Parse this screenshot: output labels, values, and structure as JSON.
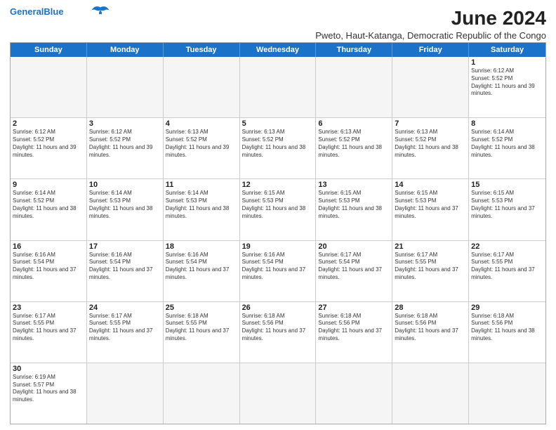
{
  "header": {
    "logo_line1": "General",
    "logo_line2": "Blue",
    "main_title": "June 2024",
    "subtitle": "Pweto, Haut-Katanga, Democratic Republic of the Congo"
  },
  "days_of_week": [
    "Sunday",
    "Monday",
    "Tuesday",
    "Wednesday",
    "Thursday",
    "Friday",
    "Saturday"
  ],
  "weeks": [
    {
      "cells": [
        {
          "day": "",
          "empty": true
        },
        {
          "day": "",
          "empty": true
        },
        {
          "day": "",
          "empty": true
        },
        {
          "day": "",
          "empty": true
        },
        {
          "day": "",
          "empty": true
        },
        {
          "day": "",
          "empty": true
        },
        {
          "day": "1",
          "sunrise": "6:12 AM",
          "sunset": "5:52 PM",
          "daylight": "11 hours and 39 minutes."
        }
      ]
    },
    {
      "cells": [
        {
          "day": "2",
          "sunrise": "6:12 AM",
          "sunset": "5:52 PM",
          "daylight": "11 hours and 39 minutes."
        },
        {
          "day": "3",
          "sunrise": "6:12 AM",
          "sunset": "5:52 PM",
          "daylight": "11 hours and 39 minutes."
        },
        {
          "day": "4",
          "sunrise": "6:13 AM",
          "sunset": "5:52 PM",
          "daylight": "11 hours and 39 minutes."
        },
        {
          "day": "5",
          "sunrise": "6:13 AM",
          "sunset": "5:52 PM",
          "daylight": "11 hours and 38 minutes."
        },
        {
          "day": "6",
          "sunrise": "6:13 AM",
          "sunset": "5:52 PM",
          "daylight": "11 hours and 38 minutes."
        },
        {
          "day": "7",
          "sunrise": "6:13 AM",
          "sunset": "5:52 PM",
          "daylight": "11 hours and 38 minutes."
        },
        {
          "day": "8",
          "sunrise": "6:14 AM",
          "sunset": "5:52 PM",
          "daylight": "11 hours and 38 minutes."
        }
      ]
    },
    {
      "cells": [
        {
          "day": "9",
          "sunrise": "6:14 AM",
          "sunset": "5:52 PM",
          "daylight": "11 hours and 38 minutes."
        },
        {
          "day": "10",
          "sunrise": "6:14 AM",
          "sunset": "5:53 PM",
          "daylight": "11 hours and 38 minutes."
        },
        {
          "day": "11",
          "sunrise": "6:14 AM",
          "sunset": "5:53 PM",
          "daylight": "11 hours and 38 minutes."
        },
        {
          "day": "12",
          "sunrise": "6:15 AM",
          "sunset": "5:53 PM",
          "daylight": "11 hours and 38 minutes."
        },
        {
          "day": "13",
          "sunrise": "6:15 AM",
          "sunset": "5:53 PM",
          "daylight": "11 hours and 38 minutes."
        },
        {
          "day": "14",
          "sunrise": "6:15 AM",
          "sunset": "5:53 PM",
          "daylight": "11 hours and 37 minutes."
        },
        {
          "day": "15",
          "sunrise": "6:15 AM",
          "sunset": "5:53 PM",
          "daylight": "11 hours and 37 minutes."
        }
      ]
    },
    {
      "cells": [
        {
          "day": "16",
          "sunrise": "6:16 AM",
          "sunset": "5:54 PM",
          "daylight": "11 hours and 37 minutes."
        },
        {
          "day": "17",
          "sunrise": "6:16 AM",
          "sunset": "5:54 PM",
          "daylight": "11 hours and 37 minutes."
        },
        {
          "day": "18",
          "sunrise": "6:16 AM",
          "sunset": "5:54 PM",
          "daylight": "11 hours and 37 minutes."
        },
        {
          "day": "19",
          "sunrise": "6:16 AM",
          "sunset": "5:54 PM",
          "daylight": "11 hours and 37 minutes."
        },
        {
          "day": "20",
          "sunrise": "6:17 AM",
          "sunset": "5:54 PM",
          "daylight": "11 hours and 37 minutes."
        },
        {
          "day": "21",
          "sunrise": "6:17 AM",
          "sunset": "5:55 PM",
          "daylight": "11 hours and 37 minutes."
        },
        {
          "day": "22",
          "sunrise": "6:17 AM",
          "sunset": "5:55 PM",
          "daylight": "11 hours and 37 minutes."
        }
      ]
    },
    {
      "cells": [
        {
          "day": "23",
          "sunrise": "6:17 AM",
          "sunset": "5:55 PM",
          "daylight": "11 hours and 37 minutes."
        },
        {
          "day": "24",
          "sunrise": "6:17 AM",
          "sunset": "5:55 PM",
          "daylight": "11 hours and 37 minutes."
        },
        {
          "day": "25",
          "sunrise": "6:18 AM",
          "sunset": "5:55 PM",
          "daylight": "11 hours and 37 minutes."
        },
        {
          "day": "26",
          "sunrise": "6:18 AM",
          "sunset": "5:56 PM",
          "daylight": "11 hours and 37 minutes."
        },
        {
          "day": "27",
          "sunrise": "6:18 AM",
          "sunset": "5:56 PM",
          "daylight": "11 hours and 37 minutes."
        },
        {
          "day": "28",
          "sunrise": "6:18 AM",
          "sunset": "5:56 PM",
          "daylight": "11 hours and 37 minutes."
        },
        {
          "day": "29",
          "sunrise": "6:18 AM",
          "sunset": "5:56 PM",
          "daylight": "11 hours and 38 minutes."
        }
      ]
    },
    {
      "cells": [
        {
          "day": "30",
          "sunrise": "6:19 AM",
          "sunset": "5:57 PM",
          "daylight": "11 hours and 38 minutes."
        },
        {
          "day": "",
          "empty": true
        },
        {
          "day": "",
          "empty": true
        },
        {
          "day": "",
          "empty": true
        },
        {
          "day": "",
          "empty": true
        },
        {
          "day": "",
          "empty": true
        },
        {
          "day": "",
          "empty": true
        }
      ]
    }
  ]
}
